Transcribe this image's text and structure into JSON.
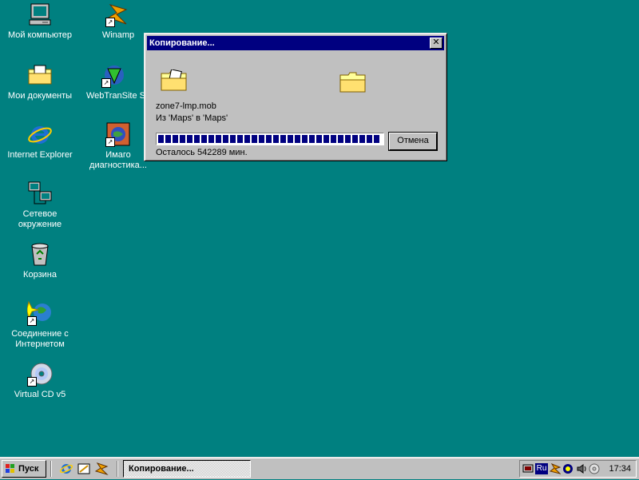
{
  "desktop": {
    "icons": [
      {
        "name": "my-computer",
        "label": "Мой компьютер"
      },
      {
        "name": "my-documents",
        "label": "Мои документы"
      },
      {
        "name": "internet-explorer",
        "label": "Internet Explorer"
      },
      {
        "name": "network",
        "label": "Сетевое\nокружение"
      },
      {
        "name": "recycle-bin",
        "label": "Корзина"
      },
      {
        "name": "internet-connection",
        "label": "Соединение с\nИнтернетом"
      },
      {
        "name": "virtual-cd",
        "label": "Virtual CD v5"
      },
      {
        "name": "winamp",
        "label": "Winamp"
      },
      {
        "name": "webtransite",
        "label": "WebTranSite S"
      },
      {
        "name": "imago",
        "label": "Имаго\nдиагностика..."
      }
    ]
  },
  "dialog": {
    "title": "Копирование...",
    "close_label": "✕",
    "filename": "zone7-lmp.mob",
    "from_to": "Из 'Maps' в 'Maps'",
    "remaining": "Осталось 542289 мин.",
    "cancel_label": "Отмена",
    "progress_fraction": 0.99
  },
  "taskbar": {
    "start_label": "Пуск",
    "task_label": "Копирование...",
    "tray_lang": "Ru",
    "clock": "17:34"
  },
  "colors": {
    "desktop": "#008080",
    "titlebar": "#000080",
    "progress": "#000080"
  }
}
